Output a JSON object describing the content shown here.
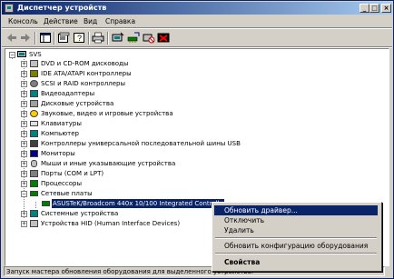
{
  "window": {
    "title": "Диспетчер устройств"
  },
  "menu": [
    "Консоль",
    "Действие",
    "Вид",
    "Справка"
  ],
  "toolbar_icons": [
    "back-icon",
    "forward-icon",
    "properties-icon",
    "help-icon",
    "print-icon",
    "scan-hardware-icon",
    "update-driver-icon",
    "disable-icon",
    "uninstall-icon"
  ],
  "tree": {
    "root": "SVS",
    "items": [
      {
        "label": "DVD и CD-ROM дисководы"
      },
      {
        "label": "IDE ATA/ATAPI контроллеры"
      },
      {
        "label": "SCSI и RAID контроллеры"
      },
      {
        "label": "Видеоадаптеры"
      },
      {
        "label": "Дисковые устройства"
      },
      {
        "label": "Звуковые, видео и игровые устройства"
      },
      {
        "label": "Клавиатуры"
      },
      {
        "label": "Компьютер"
      },
      {
        "label": "Контроллеры универсальной последовательной шины USB"
      },
      {
        "label": "Мониторы"
      },
      {
        "label": "Мыши и иные указывающие устройства"
      },
      {
        "label": "Порты (COM и LPT)"
      },
      {
        "label": "Процессоры"
      },
      {
        "label": "Сетевые платы"
      },
      {
        "label": "ASUSTeK/Broadcom 440x 10/100 Integrated Controlle"
      },
      {
        "label": "Системные устройства"
      },
      {
        "label": "Устройства HID (Human Interface Devices)"
      }
    ]
  },
  "context_menu": {
    "update_driver": "Обновить драйвер...",
    "disable": "Отключить",
    "uninstall": "Удалить",
    "scan": "Обновить конфигурацию оборудования",
    "properties": "Свойства"
  },
  "status": "Запуск мастера обновления оборудования для выделенного устройства."
}
